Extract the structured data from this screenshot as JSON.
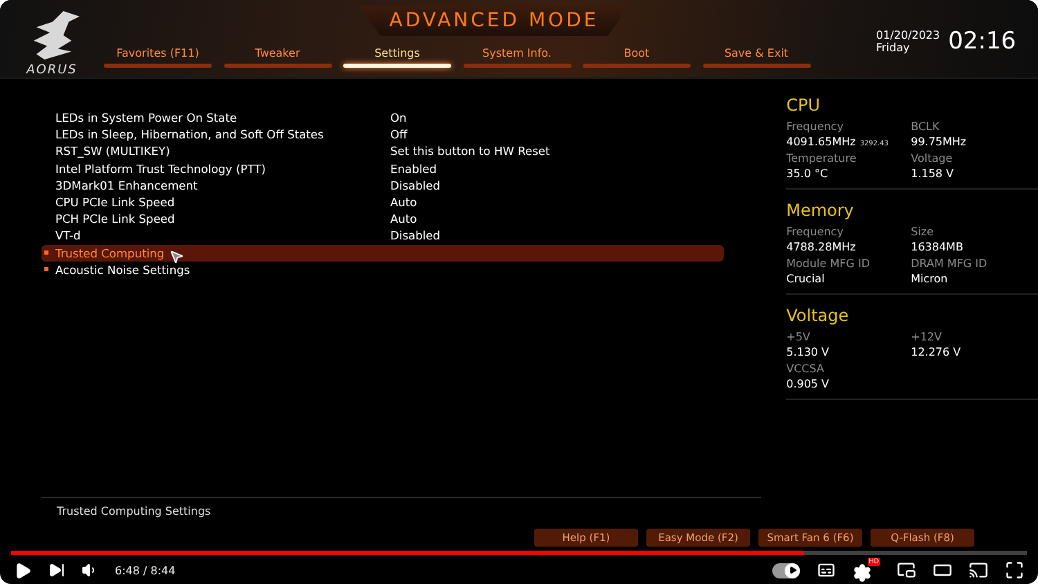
{
  "header": {
    "logo_text": "AORUS",
    "title": "ADVANCED MODE",
    "date": "01/20/2023",
    "day": "Friday",
    "time": "02:16"
  },
  "tabs": [
    {
      "label": "Favorites (F11)",
      "selected": false
    },
    {
      "label": "Tweaker",
      "selected": false
    },
    {
      "label": "Settings",
      "selected": true
    },
    {
      "label": "System Info.",
      "selected": false
    },
    {
      "label": "Boot",
      "selected": false
    },
    {
      "label": "Save & Exit",
      "selected": false
    }
  ],
  "settings": [
    {
      "kind": "option",
      "label": "LEDs in System Power On State",
      "value": "On",
      "selected": false
    },
    {
      "kind": "option",
      "label": "LEDs in Sleep, Hibernation, and Soft Off States",
      "value": "Off",
      "selected": false
    },
    {
      "kind": "option",
      "label": "RST_SW (MULTIKEY)",
      "value": "Set this button to HW Reset",
      "selected": false
    },
    {
      "kind": "option",
      "label": "Intel Platform Trust Technology (PTT)",
      "value": "Enabled",
      "selected": false
    },
    {
      "kind": "option",
      "label": "3DMark01 Enhancement",
      "value": "Disabled",
      "selected": false
    },
    {
      "kind": "option",
      "label": "CPU PCIe Link Speed",
      "value": "Auto",
      "selected": false
    },
    {
      "kind": "option",
      "label": "PCH PCIe Link Speed",
      "value": "Auto",
      "selected": false
    },
    {
      "kind": "option",
      "label": "VT-d",
      "value": "Disabled",
      "selected": false
    },
    {
      "kind": "submenu",
      "label": "Trusted Computing",
      "selected": true
    },
    {
      "kind": "submenu",
      "label": "Acoustic Noise Settings",
      "selected": false
    }
  ],
  "info_panel": [
    {
      "title": "CPU",
      "fields": [
        {
          "label": "Frequency",
          "value": "4091.65MHz",
          "note": "3292.43"
        },
        {
          "label": "BCLK",
          "value": "99.75MHz"
        },
        {
          "label": "Temperature",
          "value": "35.0 °C"
        },
        {
          "label": "Voltage",
          "value": "1.158 V"
        }
      ]
    },
    {
      "title": "Memory",
      "fields": [
        {
          "label": "Frequency",
          "value": "4788.28MHz"
        },
        {
          "label": "Size",
          "value": "16384MB"
        },
        {
          "label": "Module MFG ID",
          "value": "Crucial"
        },
        {
          "label": "DRAM MFG ID",
          "value": "Micron"
        }
      ]
    },
    {
      "title": "Voltage",
      "fields": [
        {
          "label": "+5V",
          "value": "5.130 V"
        },
        {
          "label": "+12V",
          "value": "12.276 V"
        },
        {
          "label": "VCCSA",
          "value": "0.905 V"
        }
      ]
    }
  ],
  "help_text": "Trusted Computing Settings",
  "function_keys": [
    "Help (F1)",
    "Easy Mode (F2)",
    "Smart Fan 6 (F6)",
    "Q-Flash (F8)"
  ],
  "player": {
    "time": "6:48 / 8:44",
    "level": 0.78,
    "autoplay": true,
    "quality_badge": "HD"
  }
}
